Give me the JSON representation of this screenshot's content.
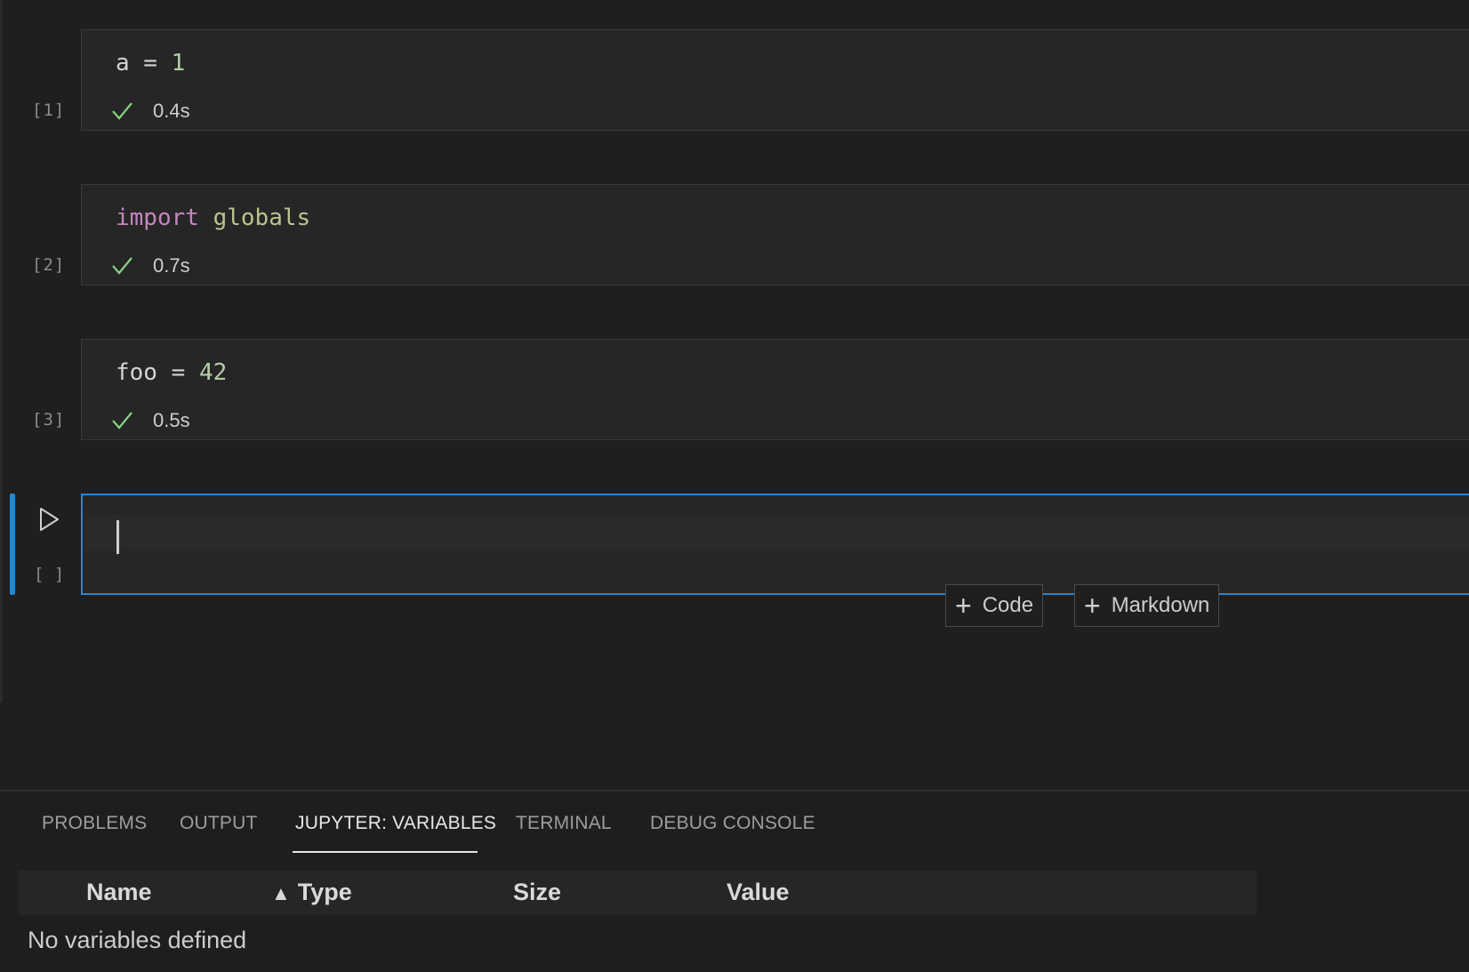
{
  "cells": [
    {
      "execution_count": "[1]",
      "duration": "0.4s"
    },
    {
      "execution_count": "[2]",
      "duration": "0.7s"
    },
    {
      "execution_count": "[3]",
      "duration": "0.5s"
    }
  ],
  "code": {
    "cell1": {
      "var": "a",
      "op": " = ",
      "value": "1"
    },
    "cell2": {
      "keyword": "import",
      "module": "globals"
    },
    "cell3": {
      "var": "foo",
      "op": " = ",
      "value": "42"
    }
  },
  "active_cell": {
    "execution_count": "[ ]"
  },
  "add_buttons": {
    "code": "Code",
    "markdown": "Markdown"
  },
  "panel": {
    "tabs": [
      "PROBLEMS",
      "OUTPUT",
      "JUPYTER: VARIABLES",
      "TERMINAL",
      "DEBUG CONSOLE"
    ],
    "active_tab": "JUPYTER: VARIABLES",
    "columns": [
      "Name",
      "Type",
      "Size",
      "Value"
    ],
    "empty_message": "No variables defined"
  },
  "colors": {
    "accent": "#2b86cf",
    "success": "#89d185",
    "keyword": "#c586c0",
    "number": "#b5cea8"
  }
}
